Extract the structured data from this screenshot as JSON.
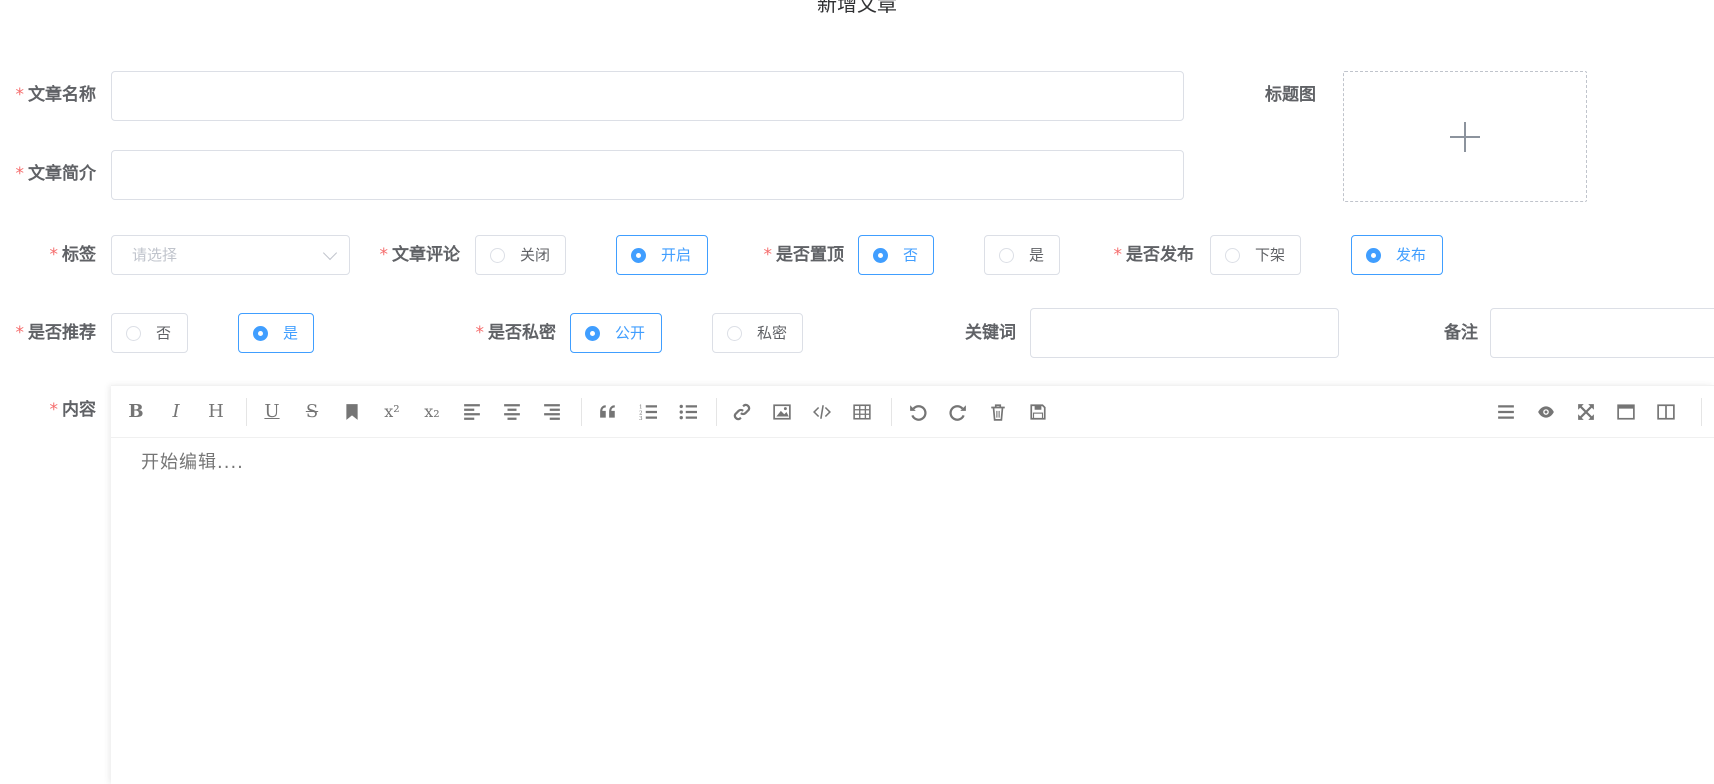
{
  "page_title": "新增文章",
  "form": {
    "required_mark": "*",
    "article_name": {
      "label": "文章名称",
      "value": ""
    },
    "article_summary": {
      "label": "文章简介",
      "value": ""
    },
    "cover_image": {
      "label": "标题图"
    },
    "tag": {
      "label": "标签",
      "placeholder": "请选择"
    },
    "comment": {
      "label": "文章评论",
      "options": [
        "关闭",
        "开启"
      ],
      "selected": "开启"
    },
    "top": {
      "label": "是否置顶",
      "options": [
        "否",
        "是"
      ],
      "selected": "否"
    },
    "publish": {
      "label": "是否发布",
      "options": [
        "下架",
        "发布"
      ],
      "selected": "发布"
    },
    "recommend": {
      "label": "是否推荐",
      "options": [
        "否",
        "是"
      ],
      "selected": "是"
    },
    "private": {
      "label": "是否私密",
      "options": [
        "公开",
        "私密"
      ],
      "selected": "公开"
    },
    "keywords": {
      "label": "关键词",
      "value": ""
    },
    "remark": {
      "label": "备注",
      "value": ""
    },
    "content": {
      "label": "内容",
      "placeholder": "开始编辑...."
    }
  },
  "editor_toolbar": {
    "bold": "B",
    "italic": "I",
    "header": "H",
    "underline": "U",
    "strikethrough": "S",
    "superscript": "x²",
    "subscript": "x₂"
  },
  "colors": {
    "primary": "#409eff",
    "required": "#f56c6c",
    "border": "#dcdfe6"
  }
}
